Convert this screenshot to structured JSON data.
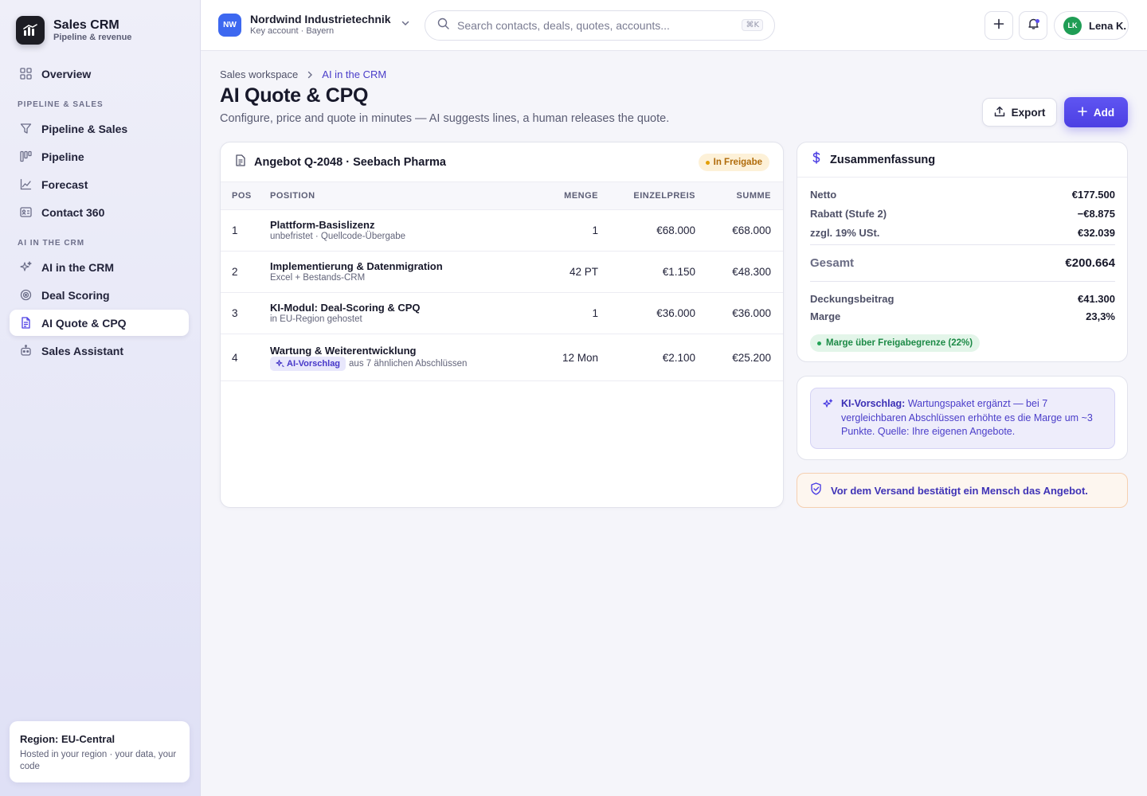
{
  "brand": {
    "title": "Sales CRM",
    "subtitle": "Pipeline & revenue"
  },
  "sidebar": {
    "overview": "Overview",
    "section_pipeline": "PIPELINE & SALES",
    "section_ai": "AI IN THE CRM",
    "items": [
      {
        "label": "Pipeline & Sales",
        "icon": "filter-icon"
      },
      {
        "label": "Pipeline",
        "icon": "kanban-icon"
      },
      {
        "label": "Forecast",
        "icon": "trend-chart-icon"
      },
      {
        "label": "Contact 360",
        "icon": "contact-card-icon"
      },
      {
        "label": "AI in the CRM",
        "icon": "sparkles-icon"
      },
      {
        "label": "Deal Scoring",
        "icon": "target-icon"
      },
      {
        "label": "AI Quote & CPQ",
        "icon": "document-icon",
        "active": true
      },
      {
        "label": "Sales Assistant",
        "icon": "bot-icon"
      }
    ],
    "region": {
      "title": "Region: EU-Central",
      "text": "Hosted in your region · your data, your code"
    }
  },
  "topbar": {
    "account": {
      "initials": "NW",
      "name": "Nordwind Industrietechnik",
      "sub": "Key account · Bayern"
    },
    "search_placeholder": "Search contacts, deals, quotes, accounts...",
    "search_shortcut": "⌘K",
    "user": {
      "initials": "LK",
      "name": "Lena K."
    }
  },
  "breadcrumb": {
    "parent": "Sales workspace",
    "current": "AI in the CRM"
  },
  "page": {
    "title": "AI Quote & CPQ",
    "subtitle": "Configure, price and quote in minutes — AI suggests lines, a human releases the quote.",
    "export_label": "Export",
    "add_label": "Add"
  },
  "quote": {
    "title": "Angebot Q-2048 · Seebach Pharma",
    "status": "In Freigabe",
    "columns": {
      "pos": "POS",
      "position": "POSITION",
      "qty": "MENGE",
      "unit": "EINZELPREIS",
      "sum": "SUMME"
    },
    "lines": [
      {
        "pos": "1",
        "name": "Plattform-Basislizenz",
        "sub": "unbefristet · Quellcode-Übergabe",
        "qty": "1",
        "unit": "€68.000",
        "sum": "€68.000"
      },
      {
        "pos": "2",
        "name": "Implementierung & Datenmigration",
        "sub": "Excel + Bestands-CRM",
        "qty": "42 PT",
        "unit": "€1.150",
        "sum": "€48.300"
      },
      {
        "pos": "3",
        "name": "KI-Modul: Deal-Scoring & CPQ",
        "sub": "in EU-Region gehostet",
        "qty": "1",
        "unit": "€36.000",
        "sum": "€36.000"
      },
      {
        "pos": "4",
        "name": "Wartung & Weiterentwicklung",
        "ai_tag": "AI-Vorschlag",
        "sub": "aus 7 ähnlichen Abschlüssen",
        "qty": "12 Mon",
        "unit": "€2.100",
        "sum": "€25.200"
      }
    ]
  },
  "summary": {
    "title": "Zusammenfassung",
    "netto_label": "Netto",
    "netto": "€177.500",
    "rabatt_label": "Rabatt (Stufe 2)",
    "rabatt": "−€8.875",
    "ust_label": "zzgl. 19% USt.",
    "ust": "€32.039",
    "total_label": "Gesamt",
    "total": "€200.664",
    "db_label": "Deckungsbeitrag",
    "db": "€41.300",
    "marge_label": "Marge",
    "marge": "23,3%",
    "margin_status": "Marge über Freigabegrenze (22%)"
  },
  "ai_suggestion": {
    "label": "KI-Vorschlag:",
    "text": "Wartungspaket ergänzt — bei 7 vergleichbaren Abschlüssen erhöhte es die Marge um ~3 Punkte. Quelle: Ihre eigenen Angebote."
  },
  "confirm_text": "Vor dem Versand bestätigt ein Mensch das Angebot.",
  "colors": {
    "accent": "#4c3fe3",
    "success": "#1c8a46",
    "warning": "#b06b0a"
  }
}
